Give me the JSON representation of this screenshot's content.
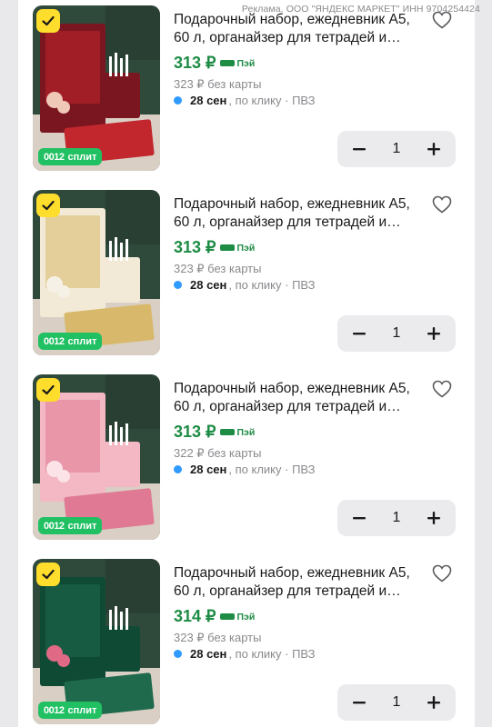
{
  "ad_label": "Реклама. ООО \"ЯНДЕКС МАРКЕТ\" ИНН 9704254424",
  "products": [
    {
      "title": "Подарочный набор, ежедневник А5, 60 л, органайзер для тетрадей и ручек",
      "price": "313 ₽",
      "pay_label": "Пэй",
      "old_price": "323 ₽  без карты",
      "delivery_date": "28 сен",
      "delivery_rest": ", по клику · ПВЗ",
      "split_dots": "0012",
      "split_label": "сплит",
      "quantity": "1",
      "theme": "#7a1620",
      "theme2": "#c2272d",
      "accent": "#f0c8b8"
    },
    {
      "title": "Подарочный набор, ежедневник А5, 60 л, органайзер для тетрадей и ручек",
      "price": "313 ₽",
      "pay_label": "Пэй",
      "old_price": "323 ₽  без карты",
      "delivery_date": "28 сен",
      "delivery_rest": ", по клику · ПВЗ",
      "split_dots": "0012",
      "split_label": "сплит",
      "quantity": "1",
      "theme": "#f2ead6",
      "theme2": "#d8b86a",
      "accent": "#f6f1e6"
    },
    {
      "title": "Подарочный набор, ежедневник А5, 60 л, органайзер для тетрадей и ручек",
      "price": "313 ₽",
      "pay_label": "Пэй",
      "old_price": "322 ₽  без карты",
      "delivery_date": "28 сен",
      "delivery_rest": ", по клику · ПВЗ",
      "split_dots": "0012",
      "split_label": "сплит",
      "quantity": "1",
      "theme": "#f3b8c4",
      "theme2": "#e07a94",
      "accent": "#fbe3e8"
    },
    {
      "title": "Подарочный набор, ежедневник А5, 60 л, органайзер для тетрадей и ручек",
      "price": "314 ₽",
      "pay_label": "Пэй",
      "old_price": "323 ₽  без карты",
      "delivery_date": "28 сен",
      "delivery_rest": ", по клику · ПВЗ",
      "split_dots": "0012",
      "split_label": "сплит",
      "quantity": "1",
      "theme": "#0f4a35",
      "theme2": "#1f6a4c",
      "accent": "#e06a86"
    }
  ],
  "colors": {
    "price_green": "#1e8c45",
    "split_green": "#21c063",
    "check_yellow": "#ffdd2d",
    "delivery_dot": "#2f9bff"
  },
  "icons": {
    "check": "check-icon",
    "favorite": "heart-outline-icon",
    "minus": "minus-icon",
    "plus": "plus-icon"
  }
}
